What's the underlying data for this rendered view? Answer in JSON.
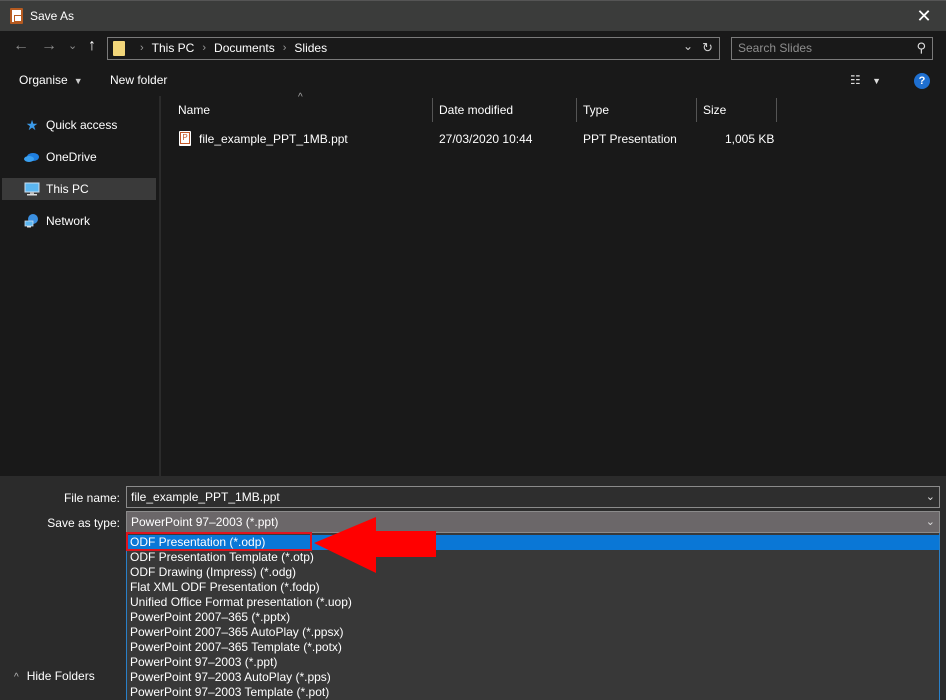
{
  "window": {
    "title": "Save As",
    "close_label": "✕"
  },
  "nav": {
    "back_icon": "←",
    "forward_icon": "→",
    "recent_icon": "⌄",
    "up_icon": "↑",
    "breadcrumb": [
      "This PC",
      "Documents",
      "Slides"
    ],
    "breadcrumb_sep": "›",
    "address_dropdown_icon": "⌄",
    "refresh_icon": "↻",
    "search_placeholder": "Search Slides",
    "search_icon": "⚲"
  },
  "toolbar": {
    "organise_label": "Organise",
    "new_folder_label": "New folder",
    "view_icon": "☷",
    "help_label": "?"
  },
  "sidebar": {
    "items": [
      {
        "label": "Quick access",
        "icon": "star-icon",
        "selected": false
      },
      {
        "label": "OneDrive",
        "icon": "cloud-icon",
        "selected": false
      },
      {
        "label": "This PC",
        "icon": "computer-icon",
        "selected": true
      },
      {
        "label": "Network",
        "icon": "network-icon",
        "selected": false
      }
    ]
  },
  "files": {
    "columns": [
      "Name",
      "Date modified",
      "Type",
      "Size"
    ],
    "sort_indicator": "^",
    "rows": [
      {
        "name": "file_example_PPT_1MB.ppt",
        "date": "27/03/2020 10:44",
        "type": "PPT Presentation",
        "size": "1,005 KB"
      }
    ]
  },
  "form": {
    "file_name_label": "File name:",
    "file_name_value": "file_example_PPT_1MB.ppt",
    "save_type_label": "Save as type:",
    "save_type_value": "PowerPoint 97–2003 (*.ppt)",
    "chevron": "⌄"
  },
  "dropdown": {
    "selected_index": 0,
    "options": [
      "ODF Presentation (*.odp)",
      "ODF Presentation Template (*.otp)",
      "ODF Drawing (Impress) (*.odg)",
      "Flat XML ODF Presentation (*.fodp)",
      "Unified Office Format presentation (*.uop)",
      "PowerPoint 2007–365 (*.pptx)",
      "PowerPoint 2007–365 AutoPlay (*.ppsx)",
      "PowerPoint 2007–365 Template (*.potx)",
      "PowerPoint 97–2003 (*.ppt)",
      "PowerPoint 97–2003 AutoPlay (*.pps)",
      "PowerPoint 97–2003 Template (*.pot)"
    ]
  },
  "footer": {
    "hide_folders_label": "Hide Folders",
    "hide_folders_icon": "^"
  },
  "annotation": {
    "color": "#e0141e"
  }
}
